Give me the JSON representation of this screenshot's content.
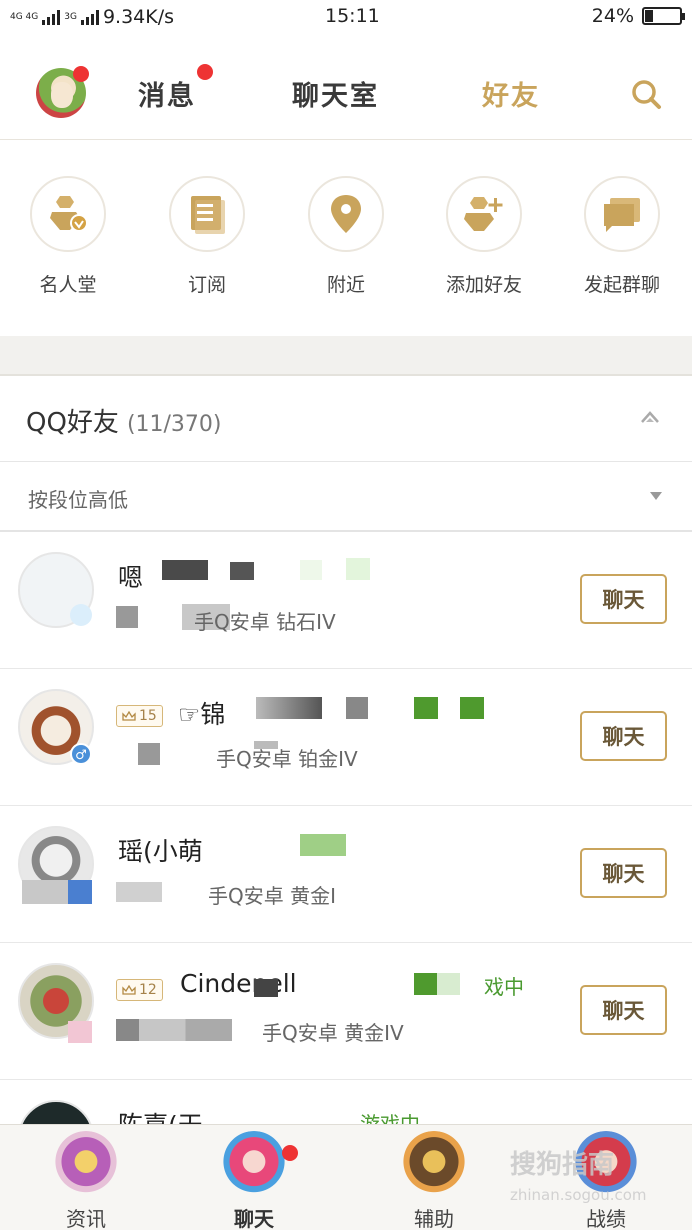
{
  "status_bar": {
    "network_left": "4G 4G",
    "network_right": "3G",
    "speed": "9.34K/s",
    "time": "15:11",
    "battery_percent_text": "24%",
    "battery_level": 0.24
  },
  "top_nav": {
    "tabs": [
      "消息",
      "聊天室",
      "好友"
    ],
    "active_tab": "好友"
  },
  "quick_actions": [
    {
      "label": "名人堂",
      "icon": "hall-of-fame-icon"
    },
    {
      "label": "订阅",
      "icon": "subscription-list-icon"
    },
    {
      "label": "附近",
      "icon": "location-pin-icon"
    },
    {
      "label": "添加好友",
      "icon": "add-friend-icon"
    },
    {
      "label": "发起群聊",
      "icon": "group-chat-icon"
    }
  ],
  "friends": {
    "title": "QQ好友",
    "count": "(11/370)",
    "sort_label": "按段位高低",
    "chat_label": "聊天",
    "rows": [
      {
        "name": "嗯",
        "level": "",
        "status": "",
        "sub": "手Q安卓 钻石IV",
        "gender": "male"
      },
      {
        "name": "☞锦",
        "level": "15",
        "status": "",
        "sub": "手Q安卓 铂金IV",
        "gender": "male"
      },
      {
        "name": "瑶(小萌",
        "level": "",
        "status": "",
        "sub": "手Q安卓 黄金I",
        "gender": ""
      },
      {
        "name": "Cindenell",
        "level": "12",
        "status": "戏中",
        "sub": "手Q安卓 黄金IV",
        "gender": ""
      },
      {
        "name": "陈嘉(天",
        "level": "",
        "status": "游戏中",
        "sub": "",
        "gender": ""
      }
    ]
  },
  "bottom_nav": {
    "items": [
      "资讯",
      "聊天",
      "辅助",
      "战绩"
    ],
    "active": "聊天"
  },
  "watermark": {
    "brand": "搜狗指南",
    "url": "zhinan.sogou.com"
  },
  "colors": {
    "accent": "#c9a45c",
    "badge_red": "#ee3333",
    "online_green": "#4a9a30"
  }
}
